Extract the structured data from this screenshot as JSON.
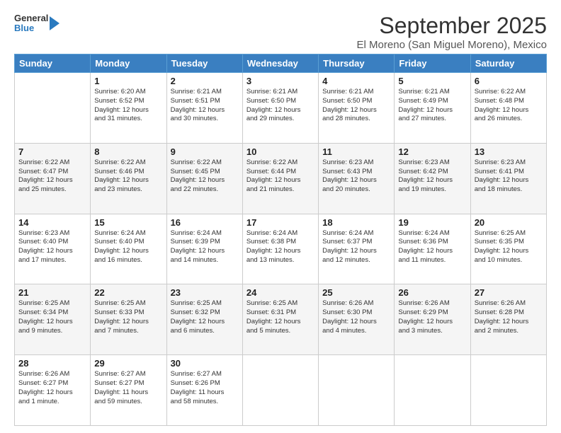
{
  "logo": {
    "general": "General",
    "blue": "Blue"
  },
  "title": "September 2025",
  "subtitle": "El Moreno (San Miguel Moreno), Mexico",
  "days": [
    "Sunday",
    "Monday",
    "Tuesday",
    "Wednesday",
    "Thursday",
    "Friday",
    "Saturday"
  ],
  "weeks": [
    [
      {
        "day": "",
        "content": ""
      },
      {
        "day": "1",
        "content": "Sunrise: 6:20 AM\nSunset: 6:52 PM\nDaylight: 12 hours\nand 31 minutes."
      },
      {
        "day": "2",
        "content": "Sunrise: 6:21 AM\nSunset: 6:51 PM\nDaylight: 12 hours\nand 30 minutes."
      },
      {
        "day": "3",
        "content": "Sunrise: 6:21 AM\nSunset: 6:50 PM\nDaylight: 12 hours\nand 29 minutes."
      },
      {
        "day": "4",
        "content": "Sunrise: 6:21 AM\nSunset: 6:50 PM\nDaylight: 12 hours\nand 28 minutes."
      },
      {
        "day": "5",
        "content": "Sunrise: 6:21 AM\nSunset: 6:49 PM\nDaylight: 12 hours\nand 27 minutes."
      },
      {
        "day": "6",
        "content": "Sunrise: 6:22 AM\nSunset: 6:48 PM\nDaylight: 12 hours\nand 26 minutes."
      }
    ],
    [
      {
        "day": "7",
        "content": "Sunrise: 6:22 AM\nSunset: 6:47 PM\nDaylight: 12 hours\nand 25 minutes."
      },
      {
        "day": "8",
        "content": "Sunrise: 6:22 AM\nSunset: 6:46 PM\nDaylight: 12 hours\nand 23 minutes."
      },
      {
        "day": "9",
        "content": "Sunrise: 6:22 AM\nSunset: 6:45 PM\nDaylight: 12 hours\nand 22 minutes."
      },
      {
        "day": "10",
        "content": "Sunrise: 6:22 AM\nSunset: 6:44 PM\nDaylight: 12 hours\nand 21 minutes."
      },
      {
        "day": "11",
        "content": "Sunrise: 6:23 AM\nSunset: 6:43 PM\nDaylight: 12 hours\nand 20 minutes."
      },
      {
        "day": "12",
        "content": "Sunrise: 6:23 AM\nSunset: 6:42 PM\nDaylight: 12 hours\nand 19 minutes."
      },
      {
        "day": "13",
        "content": "Sunrise: 6:23 AM\nSunset: 6:41 PM\nDaylight: 12 hours\nand 18 minutes."
      }
    ],
    [
      {
        "day": "14",
        "content": "Sunrise: 6:23 AM\nSunset: 6:40 PM\nDaylight: 12 hours\nand 17 minutes."
      },
      {
        "day": "15",
        "content": "Sunrise: 6:24 AM\nSunset: 6:40 PM\nDaylight: 12 hours\nand 16 minutes."
      },
      {
        "day": "16",
        "content": "Sunrise: 6:24 AM\nSunset: 6:39 PM\nDaylight: 12 hours\nand 14 minutes."
      },
      {
        "day": "17",
        "content": "Sunrise: 6:24 AM\nSunset: 6:38 PM\nDaylight: 12 hours\nand 13 minutes."
      },
      {
        "day": "18",
        "content": "Sunrise: 6:24 AM\nSunset: 6:37 PM\nDaylight: 12 hours\nand 12 minutes."
      },
      {
        "day": "19",
        "content": "Sunrise: 6:24 AM\nSunset: 6:36 PM\nDaylight: 12 hours\nand 11 minutes."
      },
      {
        "day": "20",
        "content": "Sunrise: 6:25 AM\nSunset: 6:35 PM\nDaylight: 12 hours\nand 10 minutes."
      }
    ],
    [
      {
        "day": "21",
        "content": "Sunrise: 6:25 AM\nSunset: 6:34 PM\nDaylight: 12 hours\nand 9 minutes."
      },
      {
        "day": "22",
        "content": "Sunrise: 6:25 AM\nSunset: 6:33 PM\nDaylight: 12 hours\nand 7 minutes."
      },
      {
        "day": "23",
        "content": "Sunrise: 6:25 AM\nSunset: 6:32 PM\nDaylight: 12 hours\nand 6 minutes."
      },
      {
        "day": "24",
        "content": "Sunrise: 6:25 AM\nSunset: 6:31 PM\nDaylight: 12 hours\nand 5 minutes."
      },
      {
        "day": "25",
        "content": "Sunrise: 6:26 AM\nSunset: 6:30 PM\nDaylight: 12 hours\nand 4 minutes."
      },
      {
        "day": "26",
        "content": "Sunrise: 6:26 AM\nSunset: 6:29 PM\nDaylight: 12 hours\nand 3 minutes."
      },
      {
        "day": "27",
        "content": "Sunrise: 6:26 AM\nSunset: 6:28 PM\nDaylight: 12 hours\nand 2 minutes."
      }
    ],
    [
      {
        "day": "28",
        "content": "Sunrise: 6:26 AM\nSunset: 6:27 PM\nDaylight: 12 hours\nand 1 minute."
      },
      {
        "day": "29",
        "content": "Sunrise: 6:27 AM\nSunset: 6:27 PM\nDaylight: 11 hours\nand 59 minutes."
      },
      {
        "day": "30",
        "content": "Sunrise: 6:27 AM\nSunset: 6:26 PM\nDaylight: 11 hours\nand 58 minutes."
      },
      {
        "day": "",
        "content": ""
      },
      {
        "day": "",
        "content": ""
      },
      {
        "day": "",
        "content": ""
      },
      {
        "day": "",
        "content": ""
      }
    ]
  ]
}
